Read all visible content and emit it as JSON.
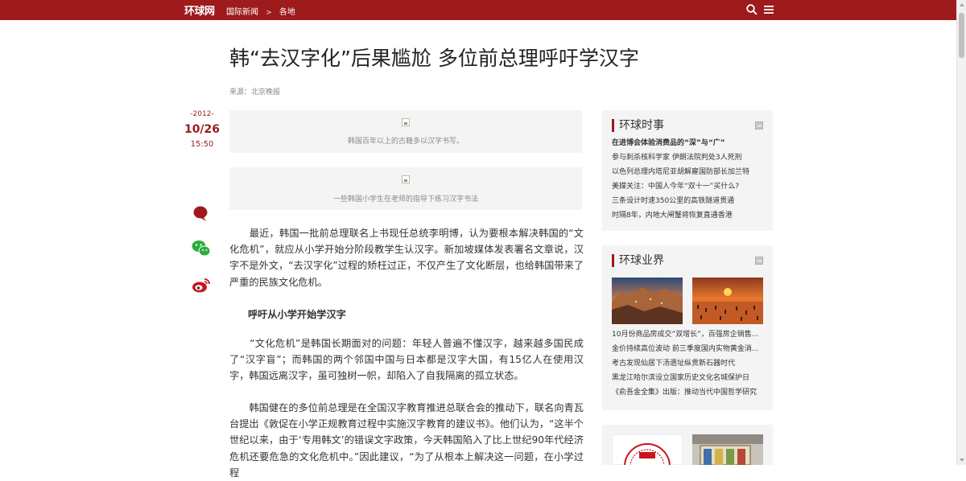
{
  "header": {
    "logo": "环球网",
    "breadcrumb": [
      "国际新闻",
      "各地"
    ],
    "breadcrumb_sep": ">",
    "icons": [
      "search-icon",
      "menu-icon"
    ],
    "brand_color": "#9e1a1c"
  },
  "article": {
    "title": "韩“去汉字化”后果尴尬 多位前总理呼吁学汉字",
    "source": "来源：北京晚报",
    "date": {
      "year": "-2012-",
      "day": "10/26",
      "time": "15:50"
    },
    "share_icons": [
      "comment-icon",
      "wechat-icon",
      "weibo-icon"
    ],
    "figures": [
      {
        "caption": "韩国百年以上的古籍多以汉字书写。"
      },
      {
        "caption": "一些韩国小学生在老师的指导下练习汉字书法"
      }
    ],
    "paragraphs": [
      "　　最近，韩国一批前总理联名上书现任总统李明博，认为要根本解决韩国的“文化危机”，就应从小学开始分阶段教学生认汉字。新加坡媒体发表署名文章说，汉字不是外文，“去汉字化”过程的矫枉过正，不仅产生了文化断层，也给韩国带来了严重的民族文化危机。",
      "　　“文化危机”是韩国长期面对的问题：年轻人普遍不懂汉字，越来越多国民成了“汉字盲”；而韩国的两个邻国中国与日本都是汉字大国，有15亿人在使用汉字，韩国远离汉字，虽可独树一帜，却陷入了自我隔离的孤立状态。",
      "　　韩国健在的多位前总理是在全国汉字教育推进总联合会的推动下，联名向青瓦台提出《敦促在小学正规教育过程中实施汉字教育的建议书》。他们认为，“这半个世纪以来，由于‘专用韩文’的错误文字政策，今天韩国陷入了比上世纪90年代经济危机还要危急的文化危机中。”因此建议，“为了从根本上解决这一问题，在小学过程"
    ],
    "subhead": "呼吁从小学开始学汉字"
  },
  "sidebar": {
    "sections": [
      {
        "title": "环球时事",
        "items": [
          "在进博会体验消费品的“深”与“广”",
          "参与刺杀核科学家 伊朗法院判处3人死刑",
          "以色列总理内塔尼亚胡解雇国防部长加兰特",
          "美媒关注：中国人今年“双十一”买什么?",
          "三条设计时速350公里的高铁隧道贯通",
          "时隔8年，内地大闸蟹将恢复直通香港"
        ]
      },
      {
        "title": "环球业界",
        "items": [
          "10月份商品房成交“双增长”，百强房企销售...",
          "金价持续高位波动 前三季度国内实物黄金消...",
          "考古发现仙居下汤遗址纵贯新石器时代",
          "黑龙江哈尔滨设立国家历史文化名城保护日",
          "《俞吾金全集》出版：推动当代中国哲学研究"
        ]
      }
    ]
  }
}
